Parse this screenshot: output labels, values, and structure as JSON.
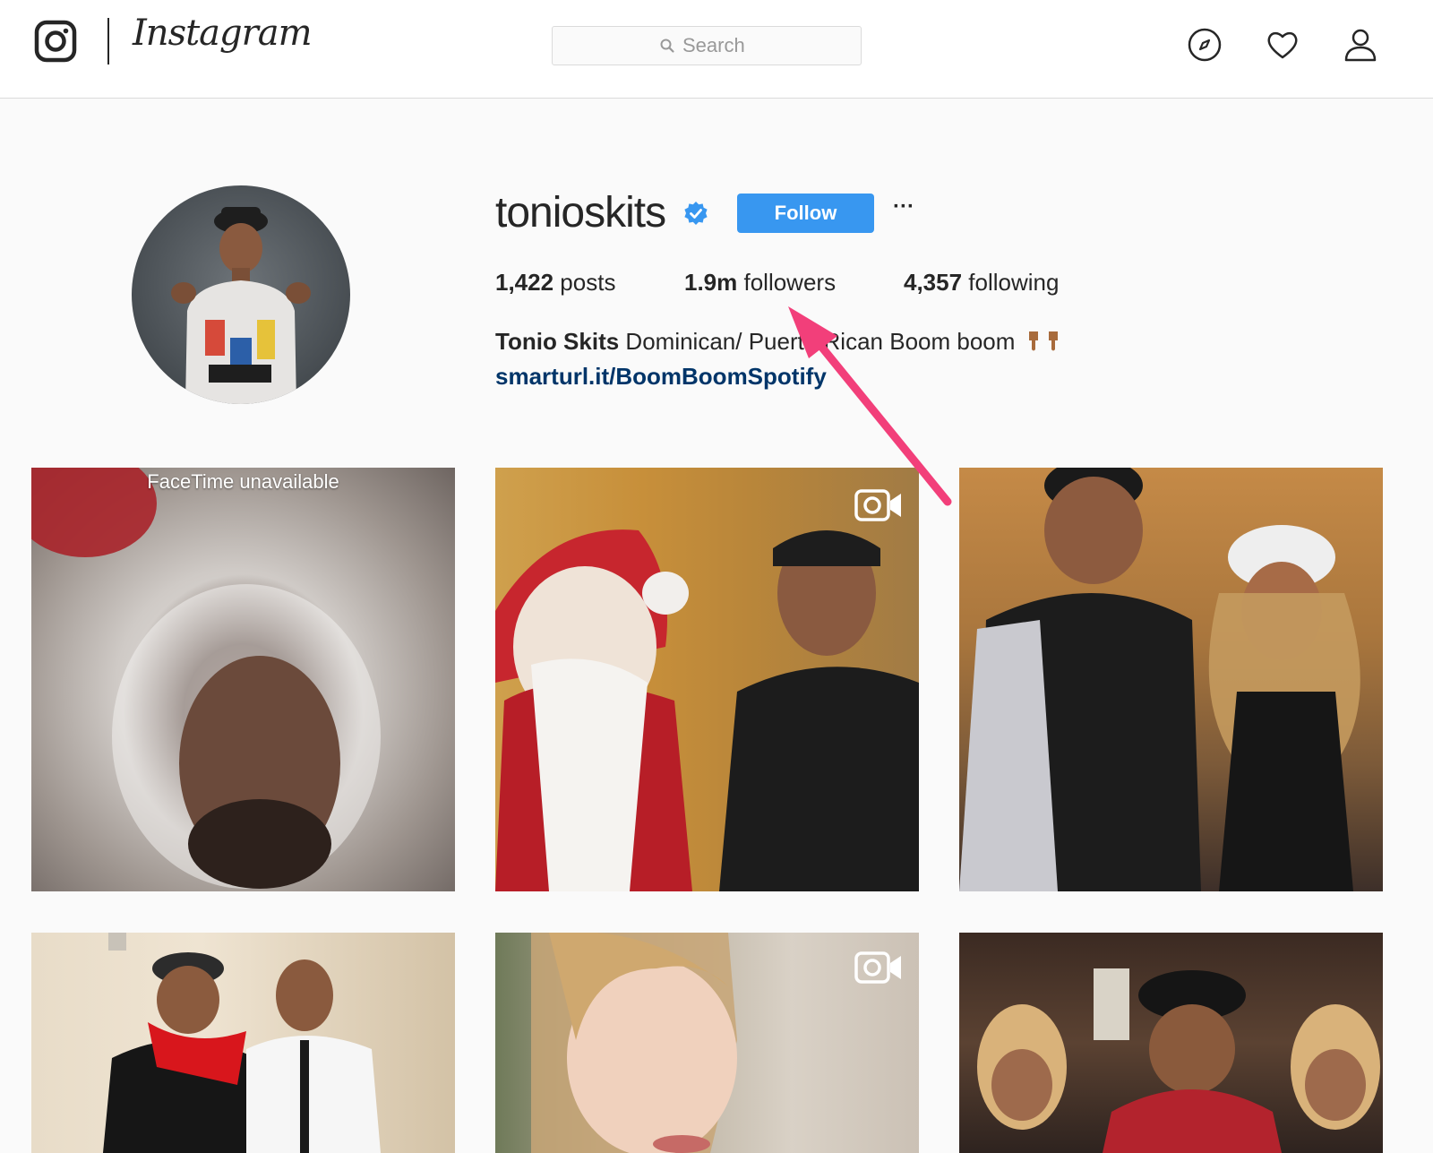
{
  "header": {
    "brand": "Instagram",
    "search": {
      "placeholder": "Search"
    },
    "icons": [
      "instagram-logo-icon",
      "compass-explore-icon",
      "heart-icon",
      "profile-icon"
    ]
  },
  "profile": {
    "username": "tonioskits",
    "verified": true,
    "follow_label": "Follow",
    "more_label": "···",
    "stats": {
      "posts_count": "1,422",
      "posts_label": " posts",
      "followers_count": "1.9m",
      "followers_label": " followers",
      "following_count": "4,357",
      "following_label": " following"
    },
    "bio": {
      "full_name": "Tonio Skits",
      "text": " Dominican/ Puerto Rican Boom boom",
      "emoji": [
        "pointing-down-emoji",
        "pointing-down-emoji"
      ],
      "link": "smarturl.it/BoomBoomSpotify"
    }
  },
  "posts": [
    {
      "caption": "FaceTime unavailable",
      "video": false
    },
    {
      "caption": "",
      "video": true
    },
    {
      "caption": "",
      "video": false
    },
    {
      "caption": "",
      "video": false
    },
    {
      "caption": "",
      "video": true
    },
    {
      "caption": "",
      "video": false
    }
  ],
  "colors": {
    "follow_button": "#3897f0",
    "link": "#003569",
    "verified_badge": "#3897f0",
    "annotation_arrow": "#f23f7a",
    "page_bg": "#fafafa",
    "border": "#dbdbdb"
  }
}
